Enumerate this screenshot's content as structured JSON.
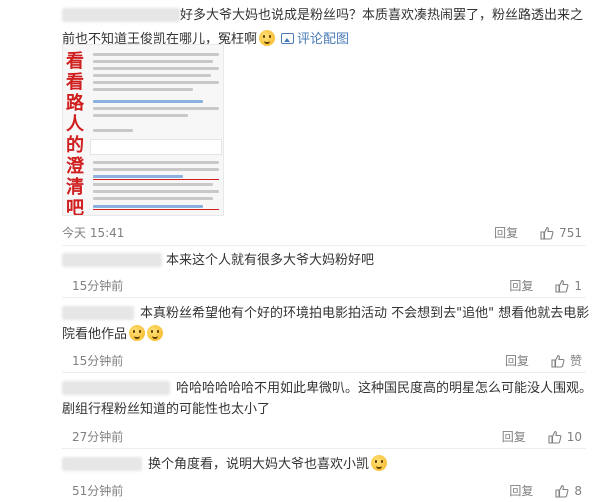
{
  "main_post": {
    "text": "好多大爷大妈也说成是粉丝吗？本质喜欢凑热闹罢了，粉丝路透出来之前也不知道王俊凯在哪儿，冤枉啊",
    "view_image_label": "评论配图",
    "image_title_chars": [
      "看",
      "看",
      "路",
      "人",
      "的",
      "澄",
      "清",
      "吧"
    ],
    "time": "今天 15:41",
    "reply_label": "回复",
    "like_count": "751"
  },
  "replies": [
    {
      "text": "本来这个人就有很多大爷大妈粉好吧",
      "time": "15分钟前",
      "reply_label": "回复",
      "like_count": "1"
    },
    {
      "text": "本真粉丝希望他有个好的环境拍电影拍活动 不会想到去\"追他\" 想看他就去电影院看他作品",
      "time": "15分钟前",
      "reply_label": "回复",
      "like_count": "赞"
    },
    {
      "text": "哈哈哈哈哈哈不用如此卑微叭。这种国民度高的明星怎么可能没人围观。剧组行程粉丝知道的可能性也太小了",
      "time": "27分钟前",
      "reply_label": "回复",
      "like_count": "10"
    },
    {
      "text": "换个角度看，说明大妈大爷也喜欢小凯",
      "time": "51分钟前",
      "reply_label": "回复",
      "like_count": "8"
    }
  ],
  "colors": {
    "username": "#eb7350",
    "link": "#4a7bb7",
    "meta": "#808080",
    "highlight": "#d01f1f"
  },
  "icons": [
    "thumb-up-icon",
    "image-icon",
    "emoji-icon"
  ]
}
